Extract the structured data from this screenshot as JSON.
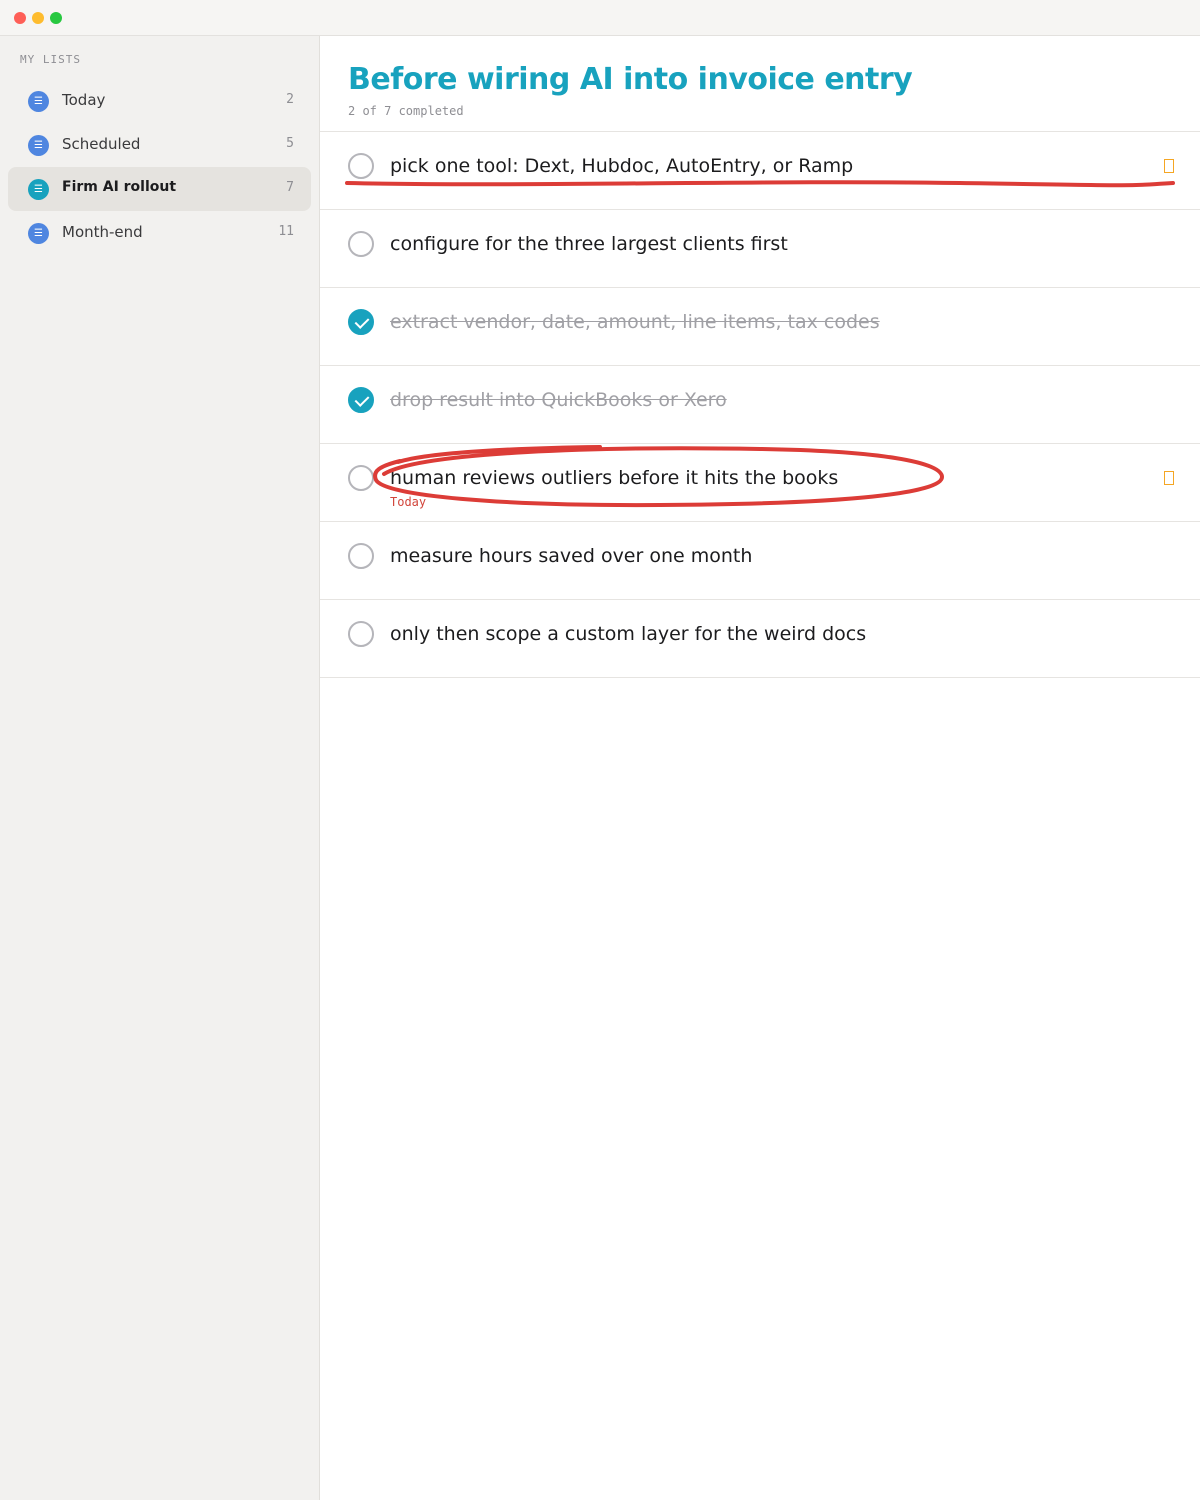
{
  "sidebar": {
    "heading": "MY LISTS",
    "items": [
      {
        "label": "Today",
        "count": "2",
        "icon": "list-icon"
      },
      {
        "label": "Scheduled",
        "count": "5",
        "icon": "list-icon"
      },
      {
        "label": "Firm AI rollout",
        "count": "7",
        "icon": "list-icon",
        "active": true
      },
      {
        "label": "Month-end",
        "count": "11",
        "icon": "list-icon"
      }
    ]
  },
  "main": {
    "title": "Before wiring AI into invoice entry",
    "subtitle": "2 of 7 completed",
    "tasks": [
      {
        "text": "pick one tool: Dext, Hubdoc, AutoEntry, or Ramp",
        "completed": false,
        "flagged": true
      },
      {
        "text": "configure for the three largest clients first",
        "completed": false
      },
      {
        "text": "extract vendor, date, amount, line items, tax codes",
        "completed": true
      },
      {
        "text": "drop result into QuickBooks or Xero",
        "completed": true
      },
      {
        "text": "human reviews outliers before it hits the books",
        "completed": false,
        "flagged": true,
        "due": "Today"
      },
      {
        "text": "measure hours saved over one month",
        "completed": false
      },
      {
        "text": "only then scope a custom layer for the weird docs",
        "completed": false
      }
    ]
  },
  "colors": {
    "accent": "#18a2be",
    "list_icon": "#4f86e0",
    "flag": "#f5a623",
    "annotation": "#dc3c37",
    "due": "#d2453b"
  }
}
